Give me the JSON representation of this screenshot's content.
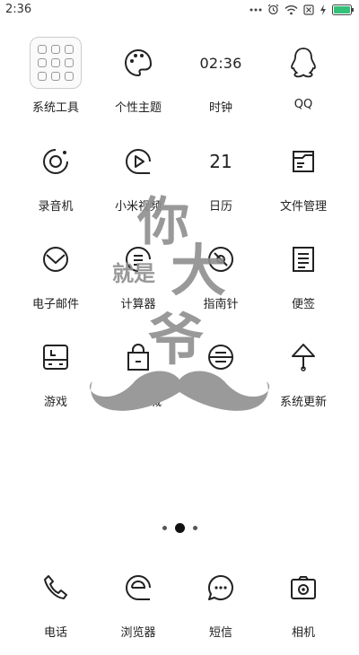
{
  "status_bar": {
    "time": "2:36"
  },
  "apps": [
    {
      "label": "系统工具",
      "icon": "tools-folder-icon"
    },
    {
      "label": "个性主题",
      "icon": "palette-icon"
    },
    {
      "label": "时钟",
      "icon": "clock-icon",
      "face": "02:36"
    },
    {
      "label": "QQ",
      "icon": "qq-penguin-icon"
    },
    {
      "label": "录音机",
      "icon": "recorder-icon"
    },
    {
      "label": "小米视频",
      "icon": "video-play-icon"
    },
    {
      "label": "日历",
      "icon": "calendar-icon",
      "face": "21"
    },
    {
      "label": "文件管理",
      "icon": "file-manager-icon"
    },
    {
      "label": "电子邮件",
      "icon": "email-icon"
    },
    {
      "label": "计算器",
      "icon": "calculator-icon"
    },
    {
      "label": "指南针",
      "icon": "compass-icon"
    },
    {
      "label": "便签",
      "icon": "notes-icon"
    },
    {
      "label": "游戏",
      "icon": "game-icon"
    },
    {
      "label": "小米商城",
      "icon": "shopping-bag-icon"
    },
    {
      "label": "米家",
      "icon": "mijia-icon"
    },
    {
      "label": "系统更新",
      "icon": "system-update-icon"
    }
  ],
  "dock": [
    {
      "label": "电话",
      "icon": "phone-icon"
    },
    {
      "label": "浏览器",
      "icon": "browser-icon"
    },
    {
      "label": "短信",
      "icon": "message-icon"
    },
    {
      "label": "相机",
      "icon": "camera-icon"
    }
  ],
  "page_indicator": {
    "count": 3,
    "active_index": 1
  },
  "wallpaper_overlay": {
    "text": "你大爷就是",
    "color": "#999999"
  }
}
